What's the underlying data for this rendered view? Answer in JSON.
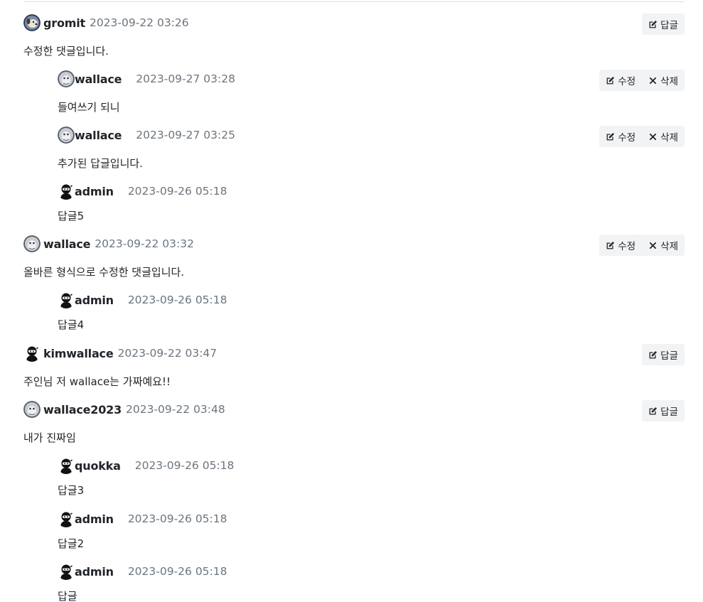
{
  "actions": {
    "reply_label": "답글",
    "edit_label": "수정",
    "delete_label": "삭제"
  },
  "comments": [
    {
      "author": "gromit",
      "date": "2023-09-22 03:26",
      "text": "수정한 댓글입니다.",
      "avatar": "avatar-gromit"
    },
    {
      "author": "wallace",
      "date": "2023-09-27 03:28",
      "text": "들여쓰기 되니",
      "avatar": "avatar-wallace"
    },
    {
      "author": "wallace",
      "date": "2023-09-27 03:25",
      "text": "추가된 답글입니다.",
      "avatar": "avatar-wallace"
    },
    {
      "author": "admin",
      "date": "2023-09-26 05:18",
      "text": "답글5",
      "avatar": "avatar-ninja"
    },
    {
      "author": "wallace",
      "date": "2023-09-22 03:32",
      "text": "올바른 형식으로 수정한 댓글입니다.",
      "avatar": "avatar-wallace"
    },
    {
      "author": "admin",
      "date": "2023-09-26 05:18",
      "text": "답글4",
      "avatar": "avatar-ninja"
    },
    {
      "author": "kimwallace",
      "date": "2023-09-22 03:47",
      "text": "주인님 저 wallace는 가짜예요!!",
      "avatar": "avatar-ninja"
    },
    {
      "author": "wallace2023",
      "date": "2023-09-22 03:48",
      "text": "내가 진짜임",
      "avatar": "avatar-wallace"
    },
    {
      "author": "quokka",
      "date": "2023-09-26 05:18",
      "text": "답글3",
      "avatar": "avatar-ninja"
    },
    {
      "author": "admin",
      "date": "2023-09-26 05:18",
      "text": "답글2",
      "avatar": "avatar-ninja"
    },
    {
      "author": "admin",
      "date": "2023-09-26 05:18",
      "text": "답글",
      "avatar": "avatar-ninja"
    }
  ]
}
